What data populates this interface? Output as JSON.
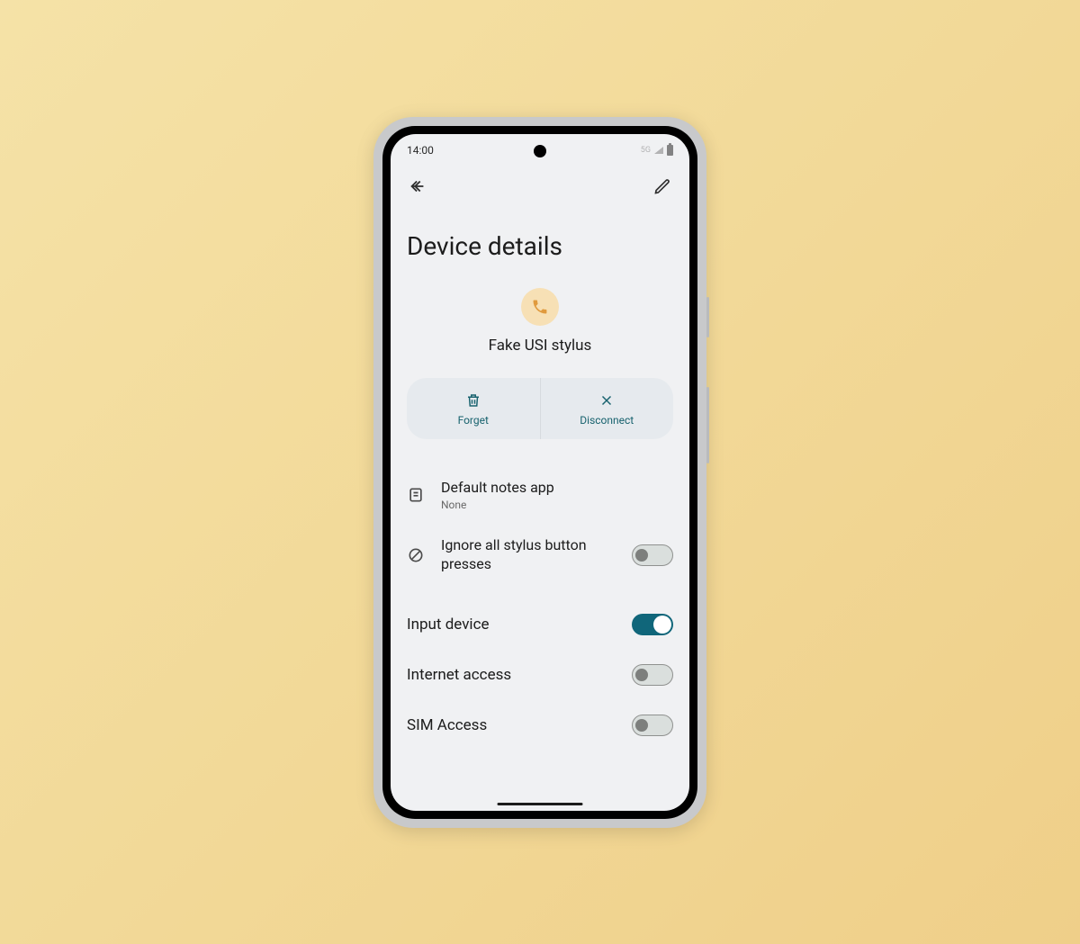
{
  "status": {
    "time": "14:00",
    "network": "5G"
  },
  "page": {
    "title": "Device details"
  },
  "device": {
    "name": "Fake USI stylus"
  },
  "actions": {
    "forget": "Forget",
    "disconnect": "Disconnect"
  },
  "settings": {
    "notes_app": {
      "label": "Default notes app",
      "value": "None"
    },
    "ignore_presses": {
      "label": "Ignore all stylus button presses",
      "on": false
    },
    "input_device": {
      "label": "Input device",
      "on": true
    },
    "internet": {
      "label": "Internet access",
      "on": false
    },
    "sim": {
      "label": "SIM Access",
      "on": false
    }
  },
  "colors": {
    "accent_teal": "#10667a",
    "action_text": "#19636f"
  }
}
